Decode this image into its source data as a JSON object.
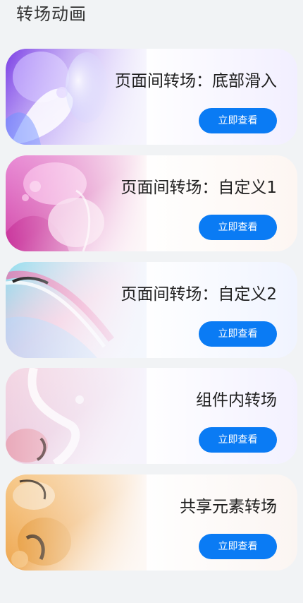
{
  "header": {
    "title": "转场动画"
  },
  "cards": [
    {
      "title": "页面间转场：底部滑入",
      "button_label": "立即查看",
      "art": "purple-glass-abstract"
    },
    {
      "title": "页面间转场：自定义1",
      "button_label": "立即查看",
      "art": "pink-bubbles-abstract"
    },
    {
      "title": "页面间转场：自定义2",
      "button_label": "立即查看",
      "art": "cyan-pink-wave-abstract"
    },
    {
      "title": "组件内转场",
      "button_label": "立即查看",
      "art": "pale-pink-glass-abstract"
    },
    {
      "title": "共享元素转场",
      "button_label": "立即查看",
      "art": "orange-gold-abstract"
    }
  ],
  "colors": {
    "background": "#f1f3f5",
    "button": "#0a7bf4",
    "button_text": "#ffffff",
    "title_text": "#1f1f1f"
  }
}
